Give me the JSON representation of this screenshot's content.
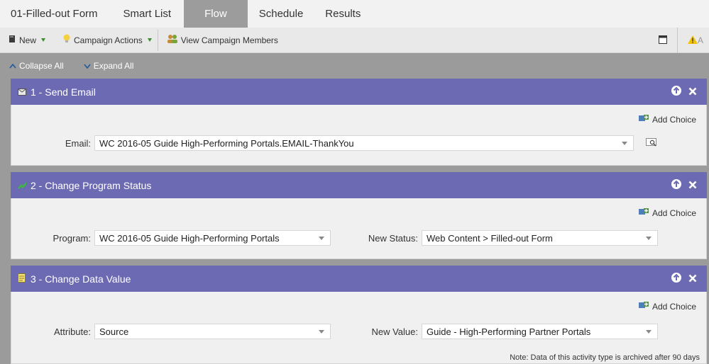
{
  "tabs": [
    {
      "label": "01-Filled-out Form",
      "active": false
    },
    {
      "label": "Smart List",
      "active": false
    },
    {
      "label": "Flow",
      "active": true
    },
    {
      "label": "Schedule",
      "active": false
    },
    {
      "label": "Results",
      "active": false
    }
  ],
  "toolbar": {
    "new_label": "New",
    "campaign_actions_label": "Campaign Actions",
    "view_members_label": "View Campaign Members",
    "right_partial_label": "A"
  },
  "collapse_all_label": "Collapse All",
  "expand_all_label": "Expand All",
  "add_choice_label": "Add Choice",
  "steps": [
    {
      "title": "1 - Send Email",
      "icon": "email-icon",
      "fields": [
        {
          "label": "Email:",
          "value": "WC 2016-05 Guide High-Performing Portals.EMAIL-ThankYou"
        }
      ]
    },
    {
      "title": "2 - Change Program Status",
      "icon": "program-status-icon",
      "fields": [
        {
          "label": "Program:",
          "value": "WC 2016-05 Guide High-Performing Portals"
        },
        {
          "label": "New Status:",
          "value": "Web Content > Filled-out Form"
        }
      ]
    },
    {
      "title": "3 - Change Data Value",
      "icon": "data-value-icon",
      "fields": [
        {
          "label": "Attribute:",
          "value": "Source"
        },
        {
          "label": "New Value:",
          "value": "Guide - High-Performing Partner Portals"
        }
      ],
      "note": "Note: Data of this activity type is archived after 90 days"
    }
  ],
  "colors": {
    "step_header": "#6c6ab2",
    "active_tab": "#9c9c9c",
    "background": "#9b9b9b"
  }
}
